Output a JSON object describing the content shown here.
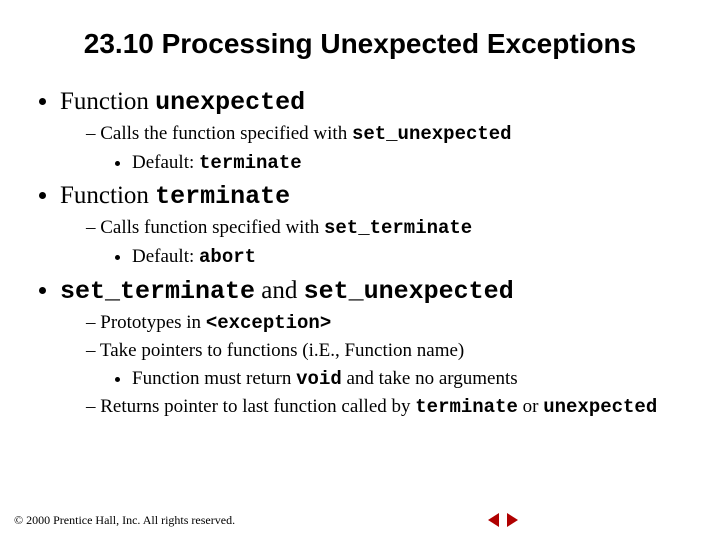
{
  "title": "23.10  Processing Unexpected Exceptions",
  "b1": {
    "label_pre": "Function ",
    "label_code": "unexpected",
    "s1_pre": "Calls the function specified with ",
    "s1_code": "set_unexpected",
    "ss1_pre": "Default: ",
    "ss1_code": "terminate"
  },
  "b2": {
    "label_pre": "Function  ",
    "label_code": "terminate",
    "s1_pre": "Calls function specified with ",
    "s1_code": "set_terminate",
    "ss1_pre": "Default: ",
    "ss1_code": "abort"
  },
  "b3": {
    "code1": "set_terminate",
    "mid": " and ",
    "code2": "set_unexpected",
    "s1_pre": "Prototypes in ",
    "s1_code": "<exception>",
    "s2": "Take pointers to functions (i.E., Function name)",
    "ss1_pre": "Function must return ",
    "ss1_code": "void",
    "ss1_post": " and take no arguments",
    "s3_pre": "Returns pointer to last function called by ",
    "s3_code1": "terminate",
    "s3_mid": " or ",
    "s3_code2": "unexpected"
  },
  "footer": "© 2000 Prentice Hall, Inc. All rights reserved."
}
